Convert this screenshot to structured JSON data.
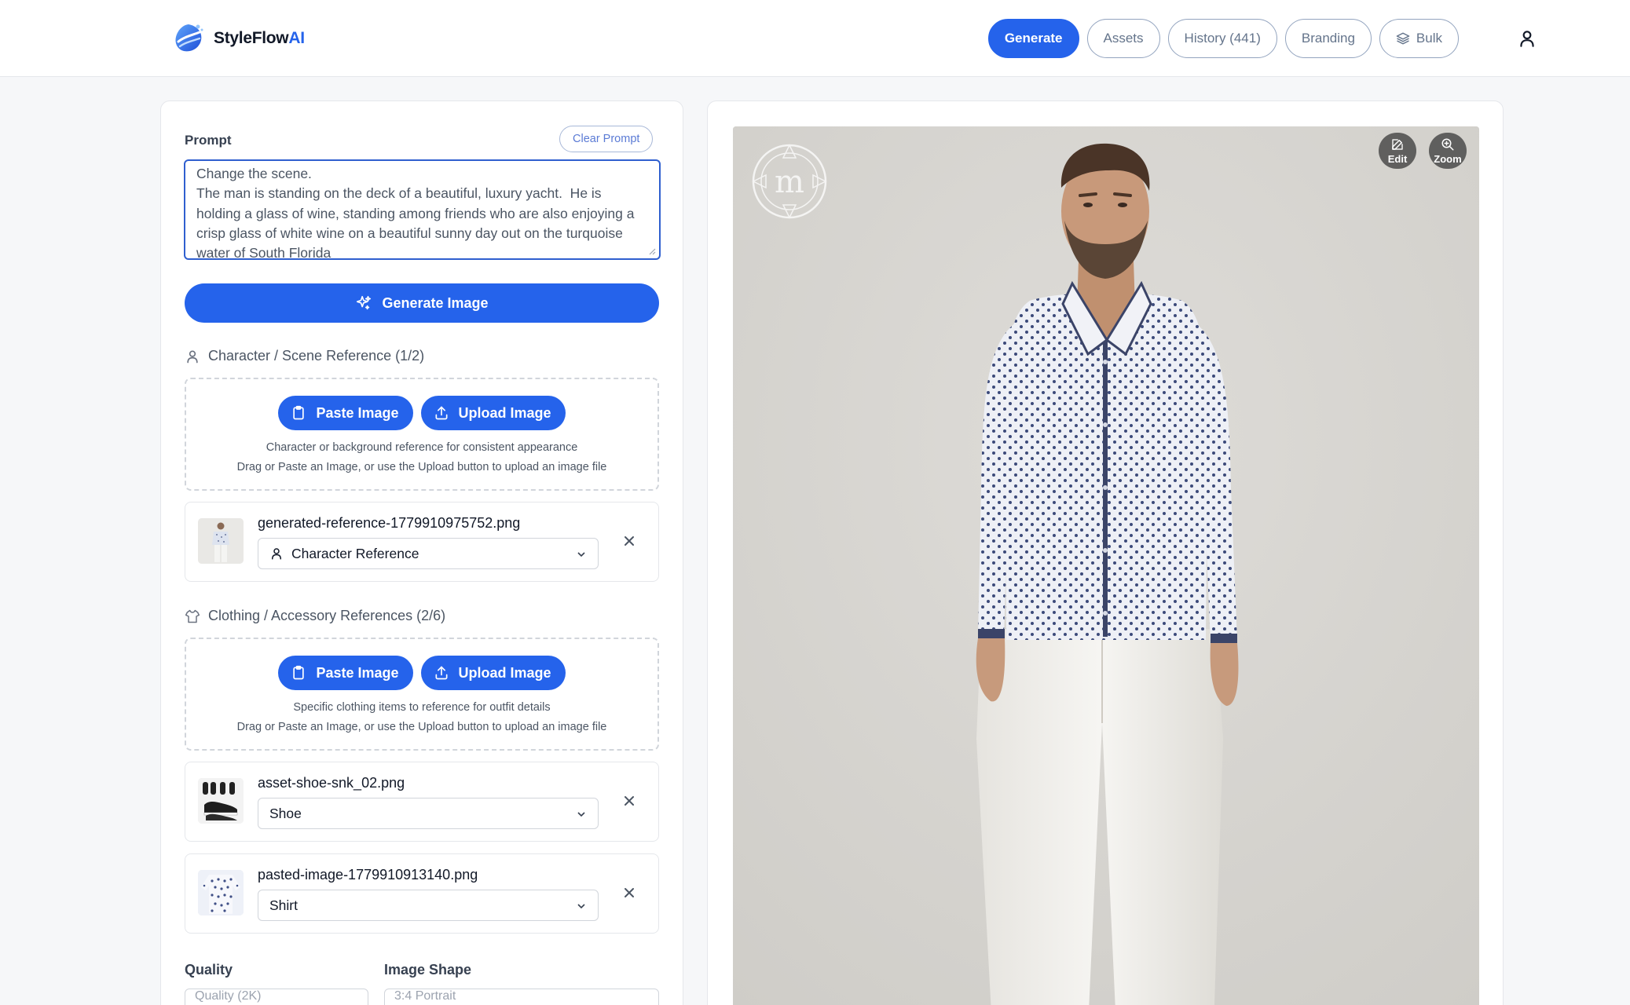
{
  "app": {
    "name_main": "StyleFlow",
    "name_accent": "AI"
  },
  "nav": {
    "generate": "Generate",
    "assets": "Assets",
    "history": "History (441)",
    "branding": "Branding",
    "bulk": "Bulk"
  },
  "prompt": {
    "label": "Prompt",
    "clear_label": "Clear Prompt",
    "text": "Change the scene.\nThe man is standing on the deck of a beautiful, luxury yacht.  He is holding a glass of wine, standing among friends who are also enjoying a crisp glass of white wine on a beautiful sunny day out on the turquoise water of South Florida",
    "generate_label": "Generate Image"
  },
  "character": {
    "heading": "Character / Scene Reference (1/2)",
    "paste_label": "Paste Image",
    "upload_label": "Upload Image",
    "hint1": "Character or background reference for consistent appearance",
    "hint2": "Drag or Paste an Image, or use the Upload button to upload an image file",
    "items": [
      {
        "filename": "generated-reference-1779910975752.png",
        "type": "Character Reference"
      }
    ]
  },
  "clothing": {
    "heading": "Clothing / Accessory References (2/6)",
    "paste_label": "Paste Image",
    "upload_label": "Upload Image",
    "hint1": "Specific clothing items to reference for outfit details",
    "hint2": "Drag or Paste an Image, or use the Upload button to upload an image file",
    "items": [
      {
        "filename": "asset-shoe-snk_02.png",
        "type": "Shoe"
      },
      {
        "filename": "pasted-image-1779910913140.png",
        "type": "Shirt"
      }
    ]
  },
  "options": {
    "quality_label": "Quality",
    "quality_value": "Quality (2K)",
    "shape_label": "Image Shape",
    "shape_value": "3:4 Portrait"
  },
  "preview": {
    "edit_label": "Edit",
    "zoom_label": "Zoom",
    "watermark_letter": "m"
  },
  "colors": {
    "accent": "#2563eb",
    "background": "#f6f7f9",
    "preview_bg": "#d7d6d2"
  }
}
